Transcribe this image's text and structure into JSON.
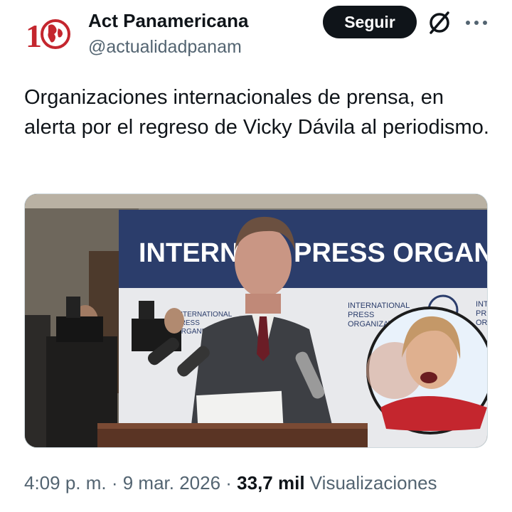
{
  "author": {
    "name": "Act Panamericana",
    "handle": "@actualidadpanam",
    "avatar_icon": "actualidad-panamericana-logo",
    "avatar_logo_text": "10"
  },
  "actions": {
    "follow_label": "Seguir",
    "grok_icon": "grok-icon",
    "more_icon": "more-icon"
  },
  "tweet": {
    "text": "Organizaciones internacionales de prensa, en alerta por el regreso de Vicky Dávila al periodismo."
  },
  "media": {
    "banner_text": "INTERNATI  PRESS ORGANIZAT",
    "banner_left": "INTERNATI",
    "banner_right": "PRESS ORGANIZAT",
    "sign_text_1": "INTERNATIONAL",
    "sign_text_2": "PRESS",
    "sign_text_3": "ORGANIZATI",
    "sign_text_4": "INT",
    "sign_text_5": "PRI",
    "sign_text_6": "OR",
    "colors": {
      "banner_blue": "#2b3d6b",
      "badge_pink": "#e93a73"
    }
  },
  "meta": {
    "time": "4:09 p. m.",
    "separator": " · ",
    "date": "9 mar. 2026",
    "views_count": "33,7 mil",
    "views_label": "Visualizaciones"
  }
}
